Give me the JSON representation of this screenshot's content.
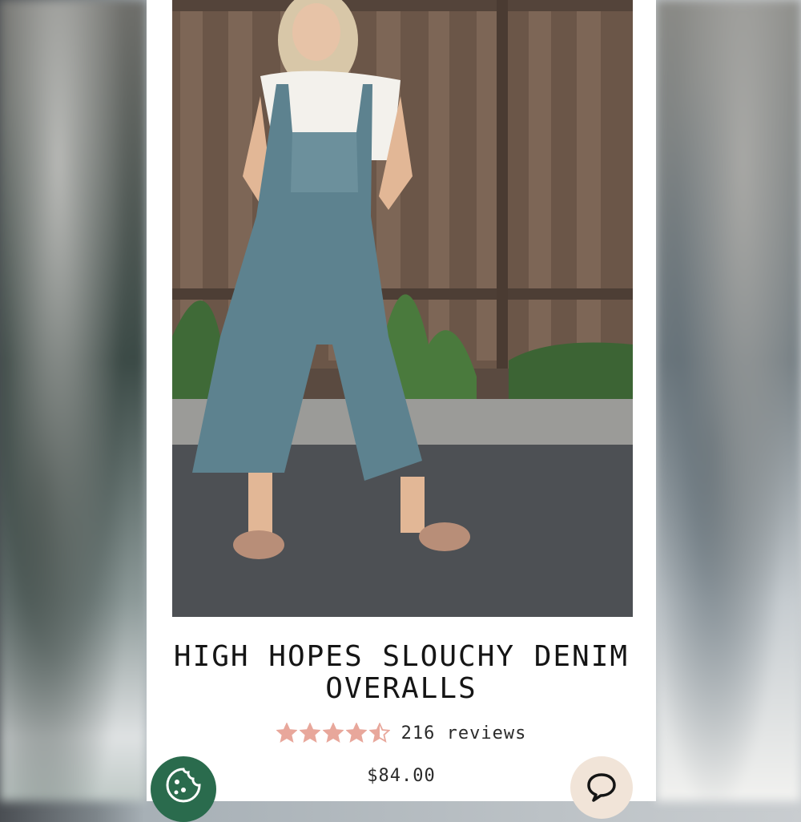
{
  "product": {
    "title": "HIGH HOPES SLOUCHY DENIM OVERALLS",
    "rating": 4.5,
    "rating_max": 5,
    "reviews_label": "216 reviews",
    "price": "$84.00"
  },
  "photo": {
    "alt": "Model wearing slouchy denim overalls"
  },
  "buttons": {
    "left_icon": "cookie-icon",
    "right_icon": "chat-bubble-icon"
  },
  "colors": {
    "star": "#e8a79b",
    "left_button": "#2a6b4d",
    "right_button": "#f1e4d8"
  }
}
